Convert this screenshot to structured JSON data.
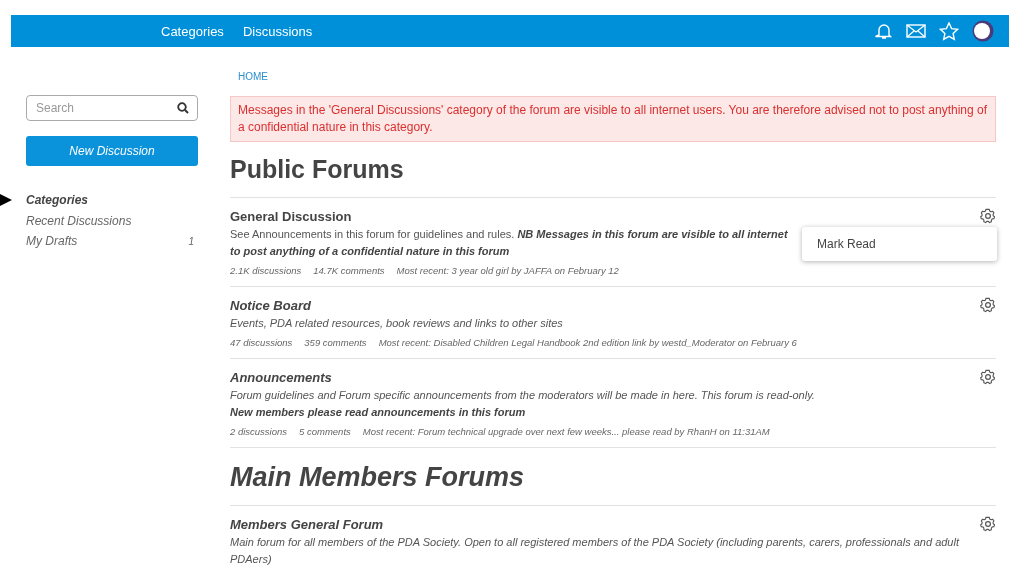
{
  "topbar": {
    "nav": [
      {
        "label": "Categories"
      },
      {
        "label": "Discussions"
      }
    ]
  },
  "sidebar": {
    "search": {
      "placeholder": "Search"
    },
    "new_button": "New Discussion",
    "items": [
      {
        "label": "Categories",
        "selected": true
      },
      {
        "label": "Recent Discussions",
        "selected": false
      },
      {
        "label": "My Drafts",
        "selected": false,
        "count": "1"
      }
    ]
  },
  "breadcrumb": "HOME",
  "alert": "Messages in the 'General Discussions' category of the forum are visible to all internet users. You are therefore advised not to post anything of a confidential nature in this category.",
  "sections": [
    {
      "title": "Public Forums",
      "italic": false,
      "forums": [
        {
          "name": "General Discussion",
          "italic": false,
          "lines": [
            "See Announcements in this forum for guidelines and rules. *NB Messages in this forum are visible to all internet*",
            "*to post anything of a confidential nature in this forum*"
          ],
          "meta": [
            "2.1K discussions",
            "14.7K comments",
            "Most recent: 3 year old girl by JAFFA on February 12"
          ],
          "menu": {
            "items": [
              "Mark Read"
            ]
          }
        },
        {
          "name": "Notice Board",
          "italic": true,
          "lines": [
            "Events, PDA related resources, book reviews and links to other sites"
          ],
          "meta": [
            "47 discussions",
            "359 comments",
            "Most recent: Disabled Children Legal Handbook 2nd edition link by westd_Moderator on February 6"
          ]
        },
        {
          "name": "Announcements",
          "italic": true,
          "lines": [
            "Forum guidelines and Forum specific announcements from the moderators will be made in here. This forum is read-only.",
            "**New members please read announcements in this forum**"
          ],
          "meta": [
            "2 discussions",
            "5 comments",
            "Most recent: Forum technical upgrade over next few weeks... please read by RhanH on 11:31AM"
          ]
        }
      ]
    },
    {
      "title": "Main Members Forums",
      "italic": true,
      "forums": [
        {
          "name": "Members General Forum",
          "italic": true,
          "lines": [
            "Main forum for all members of the PDA Society. Open to all registered members of the PDA Society (including parents, carers, professionals and adult PDAers)"
          ]
        }
      ]
    }
  ]
}
